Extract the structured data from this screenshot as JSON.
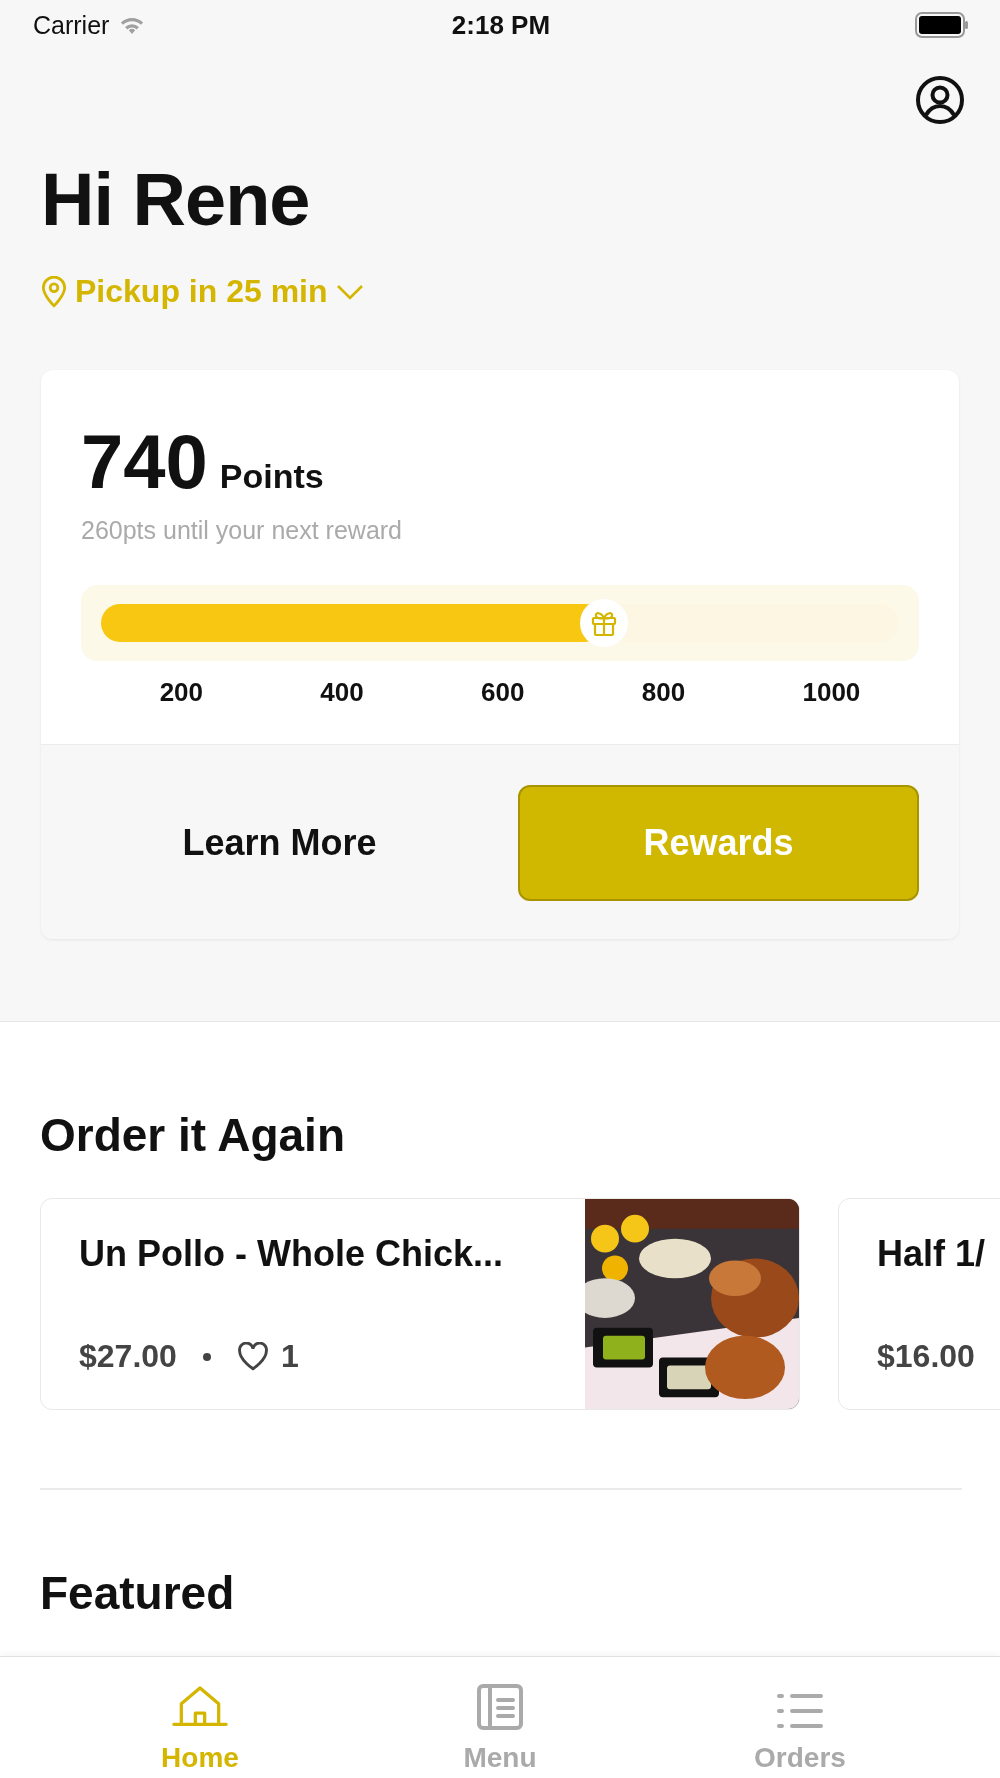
{
  "status_bar": {
    "carrier": "Carrier",
    "time": "2:18 PM"
  },
  "greeting": "Hi Rene",
  "pickup": "Pickup in 25 min",
  "points_card": {
    "points": "740",
    "points_label": "Points",
    "subtitle": "260pts until your next reward",
    "level": 0.63,
    "ticks": [
      "200",
      "400",
      "600",
      "800",
      "1000"
    ],
    "buttons": [
      {
        "label": "Learn More",
        "kind": "plain"
      },
      {
        "label": "Rewards",
        "kind": "primary"
      }
    ]
  },
  "order_again": {
    "title": "Order it Again",
    "items": [
      {
        "name": "Un Pollo - Whole Chick...",
        "price": "$27.00",
        "likes": "1",
        "kind": "picture"
      },
      {
        "name": "Half 1/",
        "price": "$16.00"
      }
    ]
  },
  "featured": {
    "title": "Featured"
  },
  "tabs": [
    {
      "label": "Home",
      "selected": true,
      "kind": "home"
    },
    {
      "label": "Menu",
      "selected": false,
      "kind": "menu"
    },
    {
      "label": "Orders",
      "selected": false,
      "kind": "orders"
    }
  ]
}
